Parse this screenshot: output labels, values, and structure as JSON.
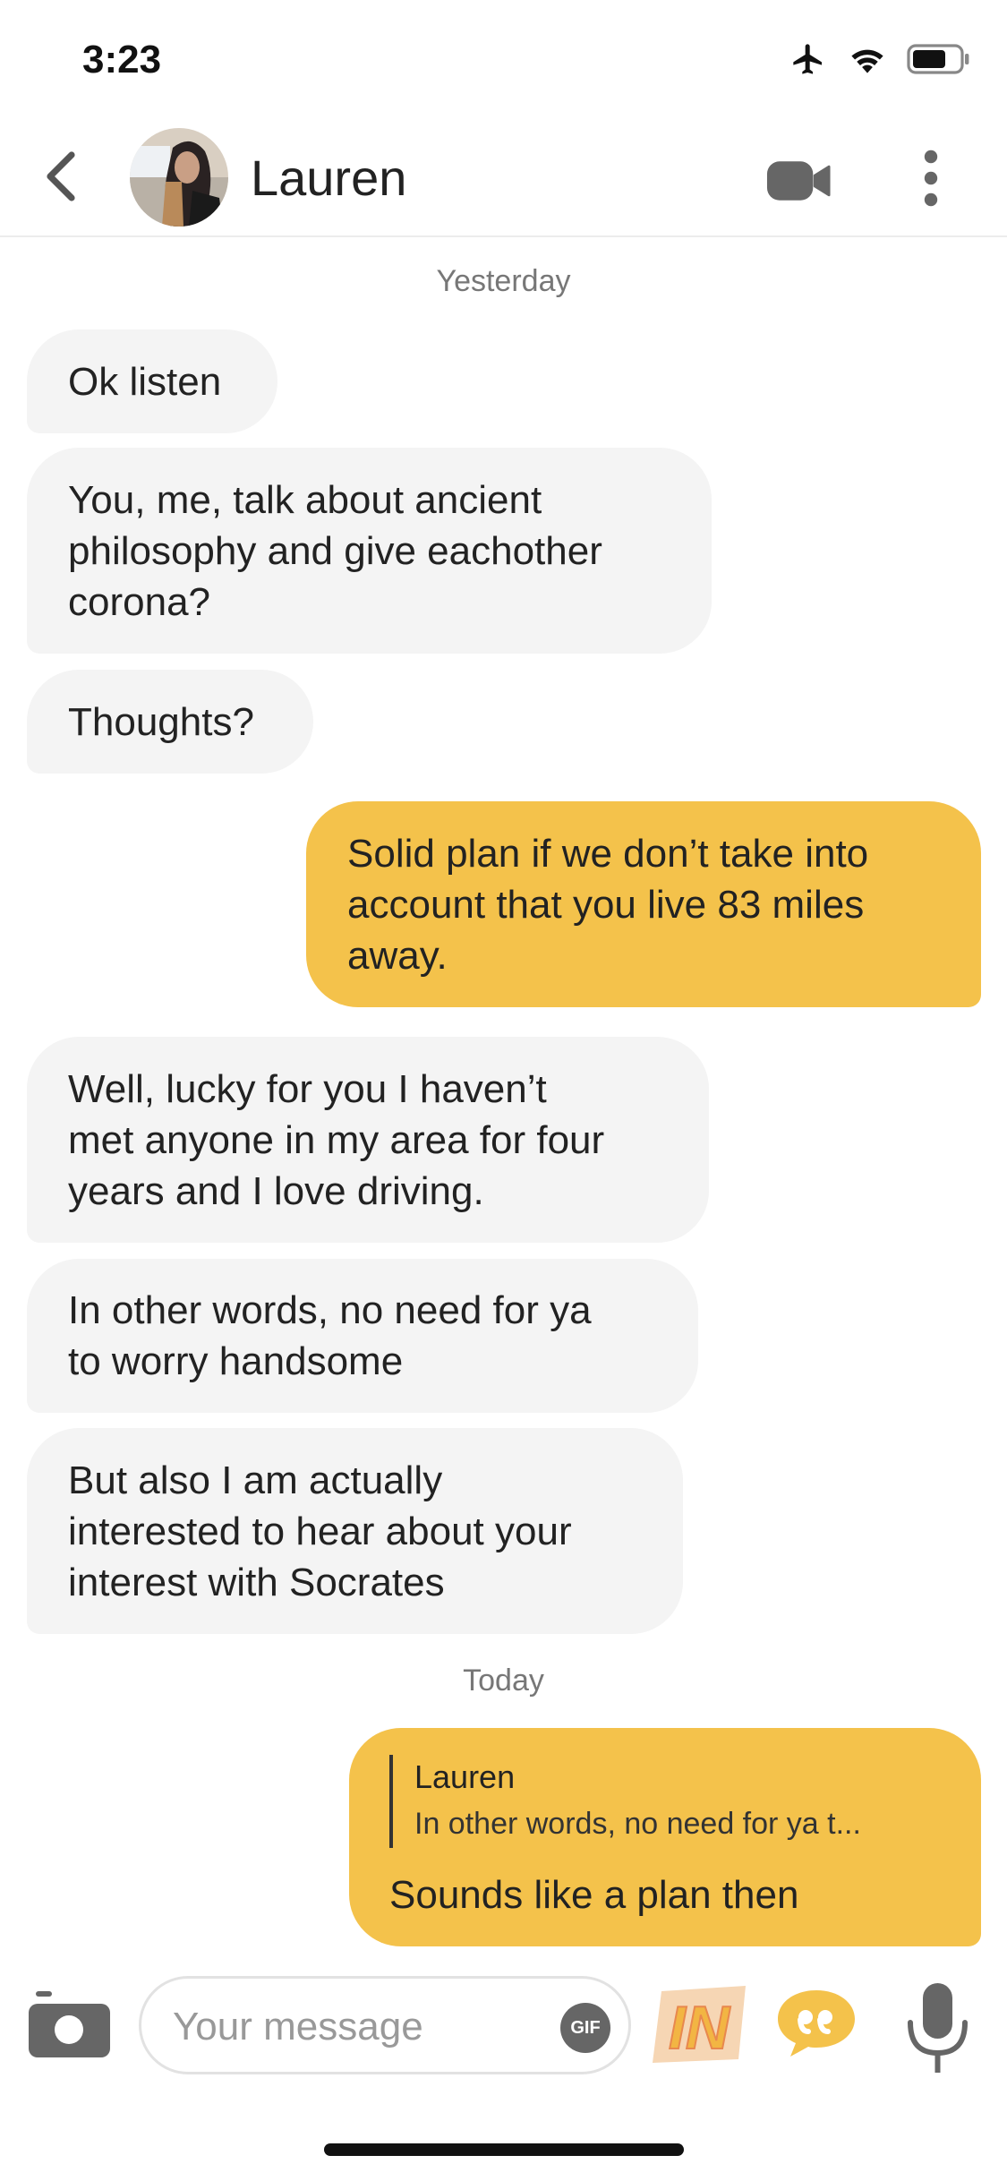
{
  "status_bar": {
    "time": "3:23"
  },
  "header": {
    "contact_name": "Lauren"
  },
  "day_separators": {
    "yesterday": "Yesterday",
    "today": "Today"
  },
  "messages": [
    {
      "direction": "in",
      "lines": [
        "Ok listen"
      ]
    },
    {
      "direction": "in",
      "lines": [
        "You, me, talk about ancient",
        "philosophy and give eachother",
        "corona?"
      ]
    },
    {
      "direction": "in",
      "lines": [
        "Thoughts?"
      ]
    },
    {
      "direction": "out",
      "lines": [
        "Solid plan if we don’t take into",
        "account that you live 83 miles",
        "away."
      ]
    },
    {
      "direction": "in",
      "lines": [
        "Well, lucky for you I haven’t",
        "met anyone in my area for four",
        "years and I love driving."
      ]
    },
    {
      "direction": "in",
      "lines": [
        "In other words, no need for ya",
        "to worry handsome"
      ]
    },
    {
      "direction": "in",
      "lines": [
        "But also I am actually",
        "interested to hear about your",
        "interest with Socrates"
      ]
    },
    {
      "direction": "out",
      "quote_name": "Lauren",
      "quote_text": "In other words, no need for ya t...",
      "lines": [
        "Sounds like a plan then"
      ]
    }
  ],
  "composer": {
    "placeholder": "Your message",
    "gif_label": "GIF",
    "in_label": "IN"
  },
  "colors": {
    "accent": "#f4c24b",
    "incoming_bubble": "#f4f4f4",
    "icon_gray": "#666666"
  },
  "icons": [
    "airplane-icon",
    "wifi-icon",
    "battery-icon",
    "back-chevron-icon",
    "video-camera-icon",
    "more-vertical-icon",
    "camera-icon",
    "gif-icon",
    "in-badge-icon",
    "quote-bubble-icon",
    "microphone-icon"
  ]
}
